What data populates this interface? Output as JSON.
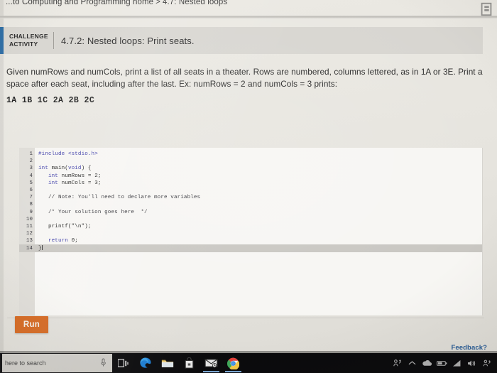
{
  "breadcrumb": {
    "trail": "...to Computing and Programming home",
    "separator": ">",
    "current": "4.7: Nested loops"
  },
  "activity": {
    "label_line1": "CHALLENGE",
    "label_line2": "ACTIVITY",
    "title": "4.7.2: Nested loops: Print seats.",
    "accent_color": "#2f6ea5"
  },
  "prompt": {
    "text": "Given numRows and numCols, print a list of all seats in a theater. Rows are numbered, columns lettered, as in 1A or 3E. Print a space after each seat, including after the last. Ex: numRows = 2 and numCols = 3 prints:",
    "example_output": "1A 1B 1C 2A 2B 2C"
  },
  "editor": {
    "language": "c",
    "active_line": 14,
    "lines": [
      {
        "n": "1",
        "tokens": [
          {
            "t": "#include",
            "c": "inc"
          },
          {
            "t": " ",
            "c": "plain"
          },
          {
            "t": "<stdio.h>",
            "c": "hdr"
          }
        ]
      },
      {
        "n": "2",
        "tokens": []
      },
      {
        "n": "3",
        "tokens": [
          {
            "t": "int",
            "c": "kw"
          },
          {
            "t": " main(",
            "c": "plain"
          },
          {
            "t": "void",
            "c": "kw"
          },
          {
            "t": ") {",
            "c": "plain"
          }
        ]
      },
      {
        "n": "4",
        "tokens": [
          {
            "t": "   ",
            "c": "plain"
          },
          {
            "t": "int",
            "c": "kw"
          },
          {
            "t": " numRows = ",
            "c": "plain"
          },
          {
            "t": "2",
            "c": "num"
          },
          {
            "t": ";",
            "c": "plain"
          }
        ]
      },
      {
        "n": "5",
        "tokens": [
          {
            "t": "   ",
            "c": "plain"
          },
          {
            "t": "int",
            "c": "kw"
          },
          {
            "t": " numCols = ",
            "c": "plain"
          },
          {
            "t": "3",
            "c": "num"
          },
          {
            "t": ";",
            "c": "plain"
          }
        ]
      },
      {
        "n": "6",
        "tokens": []
      },
      {
        "n": "7",
        "tokens": [
          {
            "t": "   ",
            "c": "plain"
          },
          {
            "t": "// Note: You'll need to declare more variables",
            "c": "cmt"
          }
        ]
      },
      {
        "n": "8",
        "tokens": []
      },
      {
        "n": "9",
        "tokens": [
          {
            "t": "   ",
            "c": "plain"
          },
          {
            "t": "/* Your solution goes here  */",
            "c": "cmt"
          }
        ]
      },
      {
        "n": "10",
        "tokens": []
      },
      {
        "n": "11",
        "tokens": [
          {
            "t": "   ",
            "c": "plain"
          },
          {
            "t": "printf(",
            "c": "fn"
          },
          {
            "t": "\"\\n\"",
            "c": "str"
          },
          {
            "t": ");",
            "c": "plain"
          }
        ]
      },
      {
        "n": "12",
        "tokens": []
      },
      {
        "n": "13",
        "tokens": [
          {
            "t": "   ",
            "c": "plain"
          },
          {
            "t": "return",
            "c": "kw"
          },
          {
            "t": " ",
            "c": "plain"
          },
          {
            "t": "0",
            "c": "num"
          },
          {
            "t": ";",
            "c": "plain"
          }
        ]
      },
      {
        "n": "14",
        "tokens": [
          {
            "t": "}",
            "c": "plain"
          }
        ]
      }
    ]
  },
  "controls": {
    "run_label": "Run",
    "run_color": "#d4651c",
    "feedback_label": "Feedback?",
    "feedback_color": "#2a5d96"
  },
  "taskbar": {
    "search_placeholder": "here to search",
    "icons": [
      {
        "name": "task-view-icon",
        "glyph": "taskview"
      },
      {
        "name": "edge-browser-icon",
        "glyph": "edge"
      },
      {
        "name": "file-explorer-icon",
        "glyph": "explorer"
      },
      {
        "name": "microsoft-store-icon",
        "glyph": "store"
      },
      {
        "name": "mail-icon",
        "glyph": "mail"
      },
      {
        "name": "chrome-browser-icon",
        "glyph": "chrome"
      }
    ],
    "tray": [
      {
        "name": "people-share-icon"
      },
      {
        "name": "show-hidden-icons-chevron"
      },
      {
        "name": "onedrive-cloud-icon"
      },
      {
        "name": "battery-icon"
      },
      {
        "name": "wifi-icon"
      },
      {
        "name": "volume-icon"
      },
      {
        "name": "action-center-icon"
      }
    ]
  }
}
